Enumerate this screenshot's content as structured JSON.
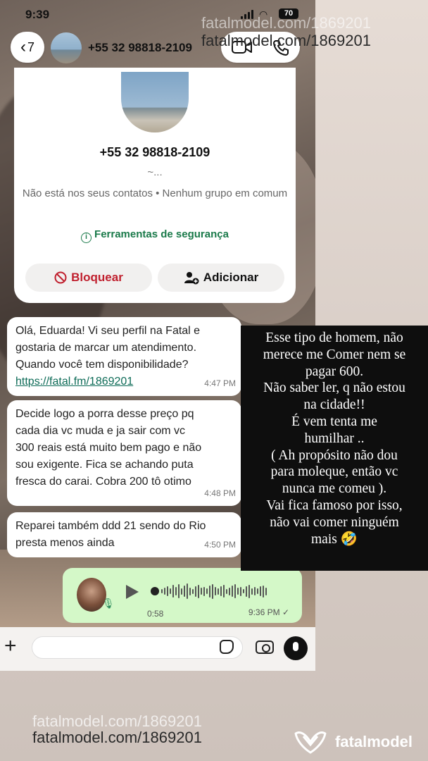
{
  "status_bar": {
    "time": "9:39",
    "battery": "70"
  },
  "header": {
    "back_count": "7",
    "contact_name": "+55 32 98818-2109"
  },
  "contact_card": {
    "phone": "+55 32 98818-2109",
    "subtitle": "~...",
    "info": "Não está nos seus contatos • Nenhum grupo em comum",
    "security_tools": "Ferramentas de segurança",
    "block_label": "Bloquear",
    "add_label": "Adicionar"
  },
  "messages": [
    {
      "text": "Olá, Eduarda! Vi seu perfil na Fatal e\ngostaria de marcar um atendimento.\nQuando você tem disponibilidade?",
      "link": "https://fatal.fm/1869201",
      "time": "4:47 PM"
    },
    {
      "text": "Decide logo a porra desse preço pq\ncada dia vc muda e ja sair com vc\n300 reais está muito bem pago e não\nsou exigente. Fica se achando puta\nfresca do carai. Cobra 200 tô otimo",
      "time": "4:48 PM"
    },
    {
      "text": "Reparei também ddd 21 sendo do Rio\npresta menos ainda",
      "time": "4:50 PM"
    }
  ],
  "voice_message": {
    "duration": "0:58",
    "time": "9:36 PM ✓"
  },
  "story_text": [
    "Esse tipo de homem, não",
    "merece me Comer nem se",
    "pagar 600.",
    "Não saber ler, q não estou",
    "na cidade!!",
    "É vem tenta me",
    "humilhar ..",
    "( Ah propósito não dou",
    "para moleque, então vc",
    "nunca me comeu ).",
    "Vai fica famoso por isso,",
    "não vai comer ninguém",
    "mais 🤣"
  ],
  "watermark": {
    "text": "fatalmodel.com/1869201",
    "logo": "fatalmodel"
  },
  "colors": {
    "link": "#0d6b57",
    "block": "#c0202e",
    "security": "#1a7a4a",
    "voice_bubble": "#d4f8c8"
  },
  "icons": [
    "chevron-left-icon",
    "video-call-icon",
    "phone-icon",
    "info-icon",
    "block-icon",
    "add-contact-icon",
    "play-icon",
    "mic-icon",
    "plus-icon",
    "sticker-icon",
    "camera-icon",
    "fatalmodel-logo-icon"
  ]
}
